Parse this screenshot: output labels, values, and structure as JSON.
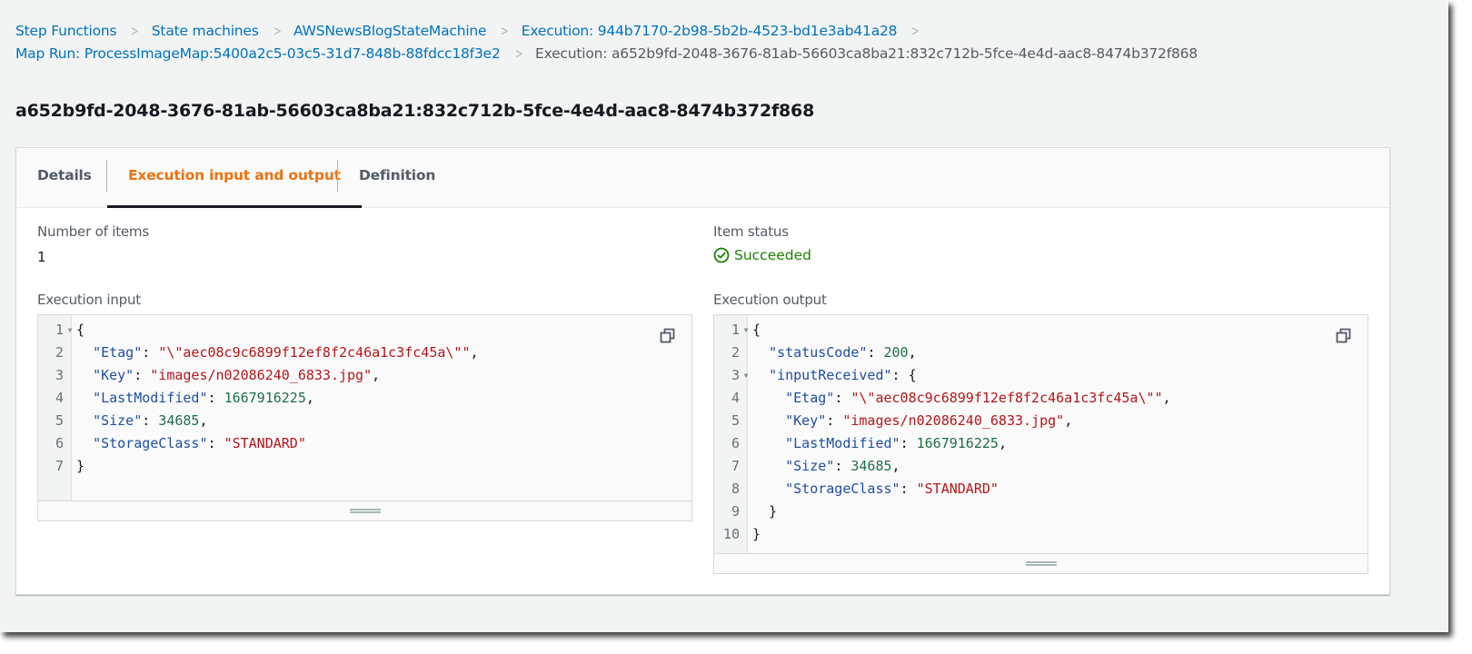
{
  "breadcrumbs": [
    {
      "label": "Step Functions",
      "link": true
    },
    {
      "label": "State machines",
      "link": true
    },
    {
      "label": "AWSNewsBlogStateMachine",
      "link": true
    },
    {
      "label": "Execution: 944b7170-2b98-5b2b-4523-bd1e3ab41a28",
      "link": true
    },
    {
      "label": "Map Run: ProcessImageMap:5400a2c5-03c5-31d7-848b-88fdcc18f3e2",
      "link": true
    },
    {
      "label": "Execution: a652b9fd-2048-3676-81ab-56603ca8ba21:832c712b-5fce-4e4d-aac8-8474b372f868",
      "link": false
    }
  ],
  "page_title": "a652b9fd-2048-3676-81ab-56603ca8ba21:832c712b-5fce-4e4d-aac8-8474b372f868",
  "tabs": [
    {
      "label": "Details",
      "active": false
    },
    {
      "label": "Execution input and output",
      "active": true
    },
    {
      "label": "Definition",
      "active": false
    }
  ],
  "summary": {
    "items_label": "Number of items",
    "items_value": "1",
    "status_label": "Item status",
    "status_value": "Succeeded",
    "status_icon": "check-circle-icon",
    "status_color": "#1d8102"
  },
  "input_panel": {
    "label": "Execution input",
    "copy_icon": "copy-icon",
    "lines": [
      {
        "num": "1",
        "fold": true,
        "tokens": [
          [
            "p",
            "{"
          ]
        ]
      },
      {
        "num": "2",
        "fold": false,
        "tokens": [
          [
            "p",
            "  "
          ],
          [
            "k",
            "\"Etag\""
          ],
          [
            "p",
            ": "
          ],
          [
            "s",
            "\"\\\"aec08c9c6899f12ef8f2c46a1c3fc45a\\\"\""
          ],
          [
            "p",
            ","
          ]
        ]
      },
      {
        "num": "3",
        "fold": false,
        "tokens": [
          [
            "p",
            "  "
          ],
          [
            "k",
            "\"Key\""
          ],
          [
            "p",
            ": "
          ],
          [
            "s",
            "\"images/n02086240_6833.jpg\""
          ],
          [
            "p",
            ","
          ]
        ]
      },
      {
        "num": "4",
        "fold": false,
        "tokens": [
          [
            "p",
            "  "
          ],
          [
            "k",
            "\"LastModified\""
          ],
          [
            "p",
            ": "
          ],
          [
            "n",
            "1667916225"
          ],
          [
            "p",
            ","
          ]
        ]
      },
      {
        "num": "5",
        "fold": false,
        "tokens": [
          [
            "p",
            "  "
          ],
          [
            "k",
            "\"Size\""
          ],
          [
            "p",
            ": "
          ],
          [
            "n",
            "34685"
          ],
          [
            "p",
            ","
          ]
        ]
      },
      {
        "num": "6",
        "fold": false,
        "tokens": [
          [
            "p",
            "  "
          ],
          [
            "k",
            "\"StorageClass\""
          ],
          [
            "p",
            ": "
          ],
          [
            "s",
            "\"STANDARD\""
          ]
        ]
      },
      {
        "num": "7",
        "fold": false,
        "tokens": [
          [
            "p",
            "}"
          ]
        ]
      }
    ]
  },
  "output_panel": {
    "label": "Execution output",
    "copy_icon": "copy-icon",
    "lines": [
      {
        "num": "1",
        "fold": true,
        "tokens": [
          [
            "p",
            "{"
          ]
        ]
      },
      {
        "num": "2",
        "fold": false,
        "tokens": [
          [
            "p",
            "  "
          ],
          [
            "k",
            "\"statusCode\""
          ],
          [
            "p",
            ": "
          ],
          [
            "n",
            "200"
          ],
          [
            "p",
            ","
          ]
        ]
      },
      {
        "num": "3",
        "fold": true,
        "tokens": [
          [
            "p",
            "  "
          ],
          [
            "k",
            "\"inputReceived\""
          ],
          [
            "p",
            ": {"
          ]
        ]
      },
      {
        "num": "4",
        "fold": false,
        "tokens": [
          [
            "p",
            "    "
          ],
          [
            "k",
            "\"Etag\""
          ],
          [
            "p",
            ": "
          ],
          [
            "s",
            "\"\\\"aec08c9c6899f12ef8f2c46a1c3fc45a\\\"\""
          ],
          [
            "p",
            ","
          ]
        ]
      },
      {
        "num": "5",
        "fold": false,
        "tokens": [
          [
            "p",
            "    "
          ],
          [
            "k",
            "\"Key\""
          ],
          [
            "p",
            ": "
          ],
          [
            "s",
            "\"images/n02086240_6833.jpg\""
          ],
          [
            "p",
            ","
          ]
        ]
      },
      {
        "num": "6",
        "fold": false,
        "tokens": [
          [
            "p",
            "    "
          ],
          [
            "k",
            "\"LastModified\""
          ],
          [
            "p",
            ": "
          ],
          [
            "n",
            "1667916225"
          ],
          [
            "p",
            ","
          ]
        ]
      },
      {
        "num": "7",
        "fold": false,
        "tokens": [
          [
            "p",
            "    "
          ],
          [
            "k",
            "\"Size\""
          ],
          [
            "p",
            ": "
          ],
          [
            "n",
            "34685"
          ],
          [
            "p",
            ","
          ]
        ]
      },
      {
        "num": "8",
        "fold": false,
        "tokens": [
          [
            "p",
            "    "
          ],
          [
            "k",
            "\"StorageClass\""
          ],
          [
            "p",
            ": "
          ],
          [
            "s",
            "\"STANDARD\""
          ]
        ]
      },
      {
        "num": "9",
        "fold": false,
        "tokens": [
          [
            "p",
            "  }"
          ]
        ]
      },
      {
        "num": "10",
        "fold": false,
        "tokens": [
          [
            "p",
            "}"
          ]
        ]
      }
    ]
  },
  "colors": {
    "link": "#0073bb",
    "active_tab": "#ec7211",
    "json_key": "#1f4fa0",
    "json_string": "#b3161a",
    "json_number": "#1e6e46"
  }
}
